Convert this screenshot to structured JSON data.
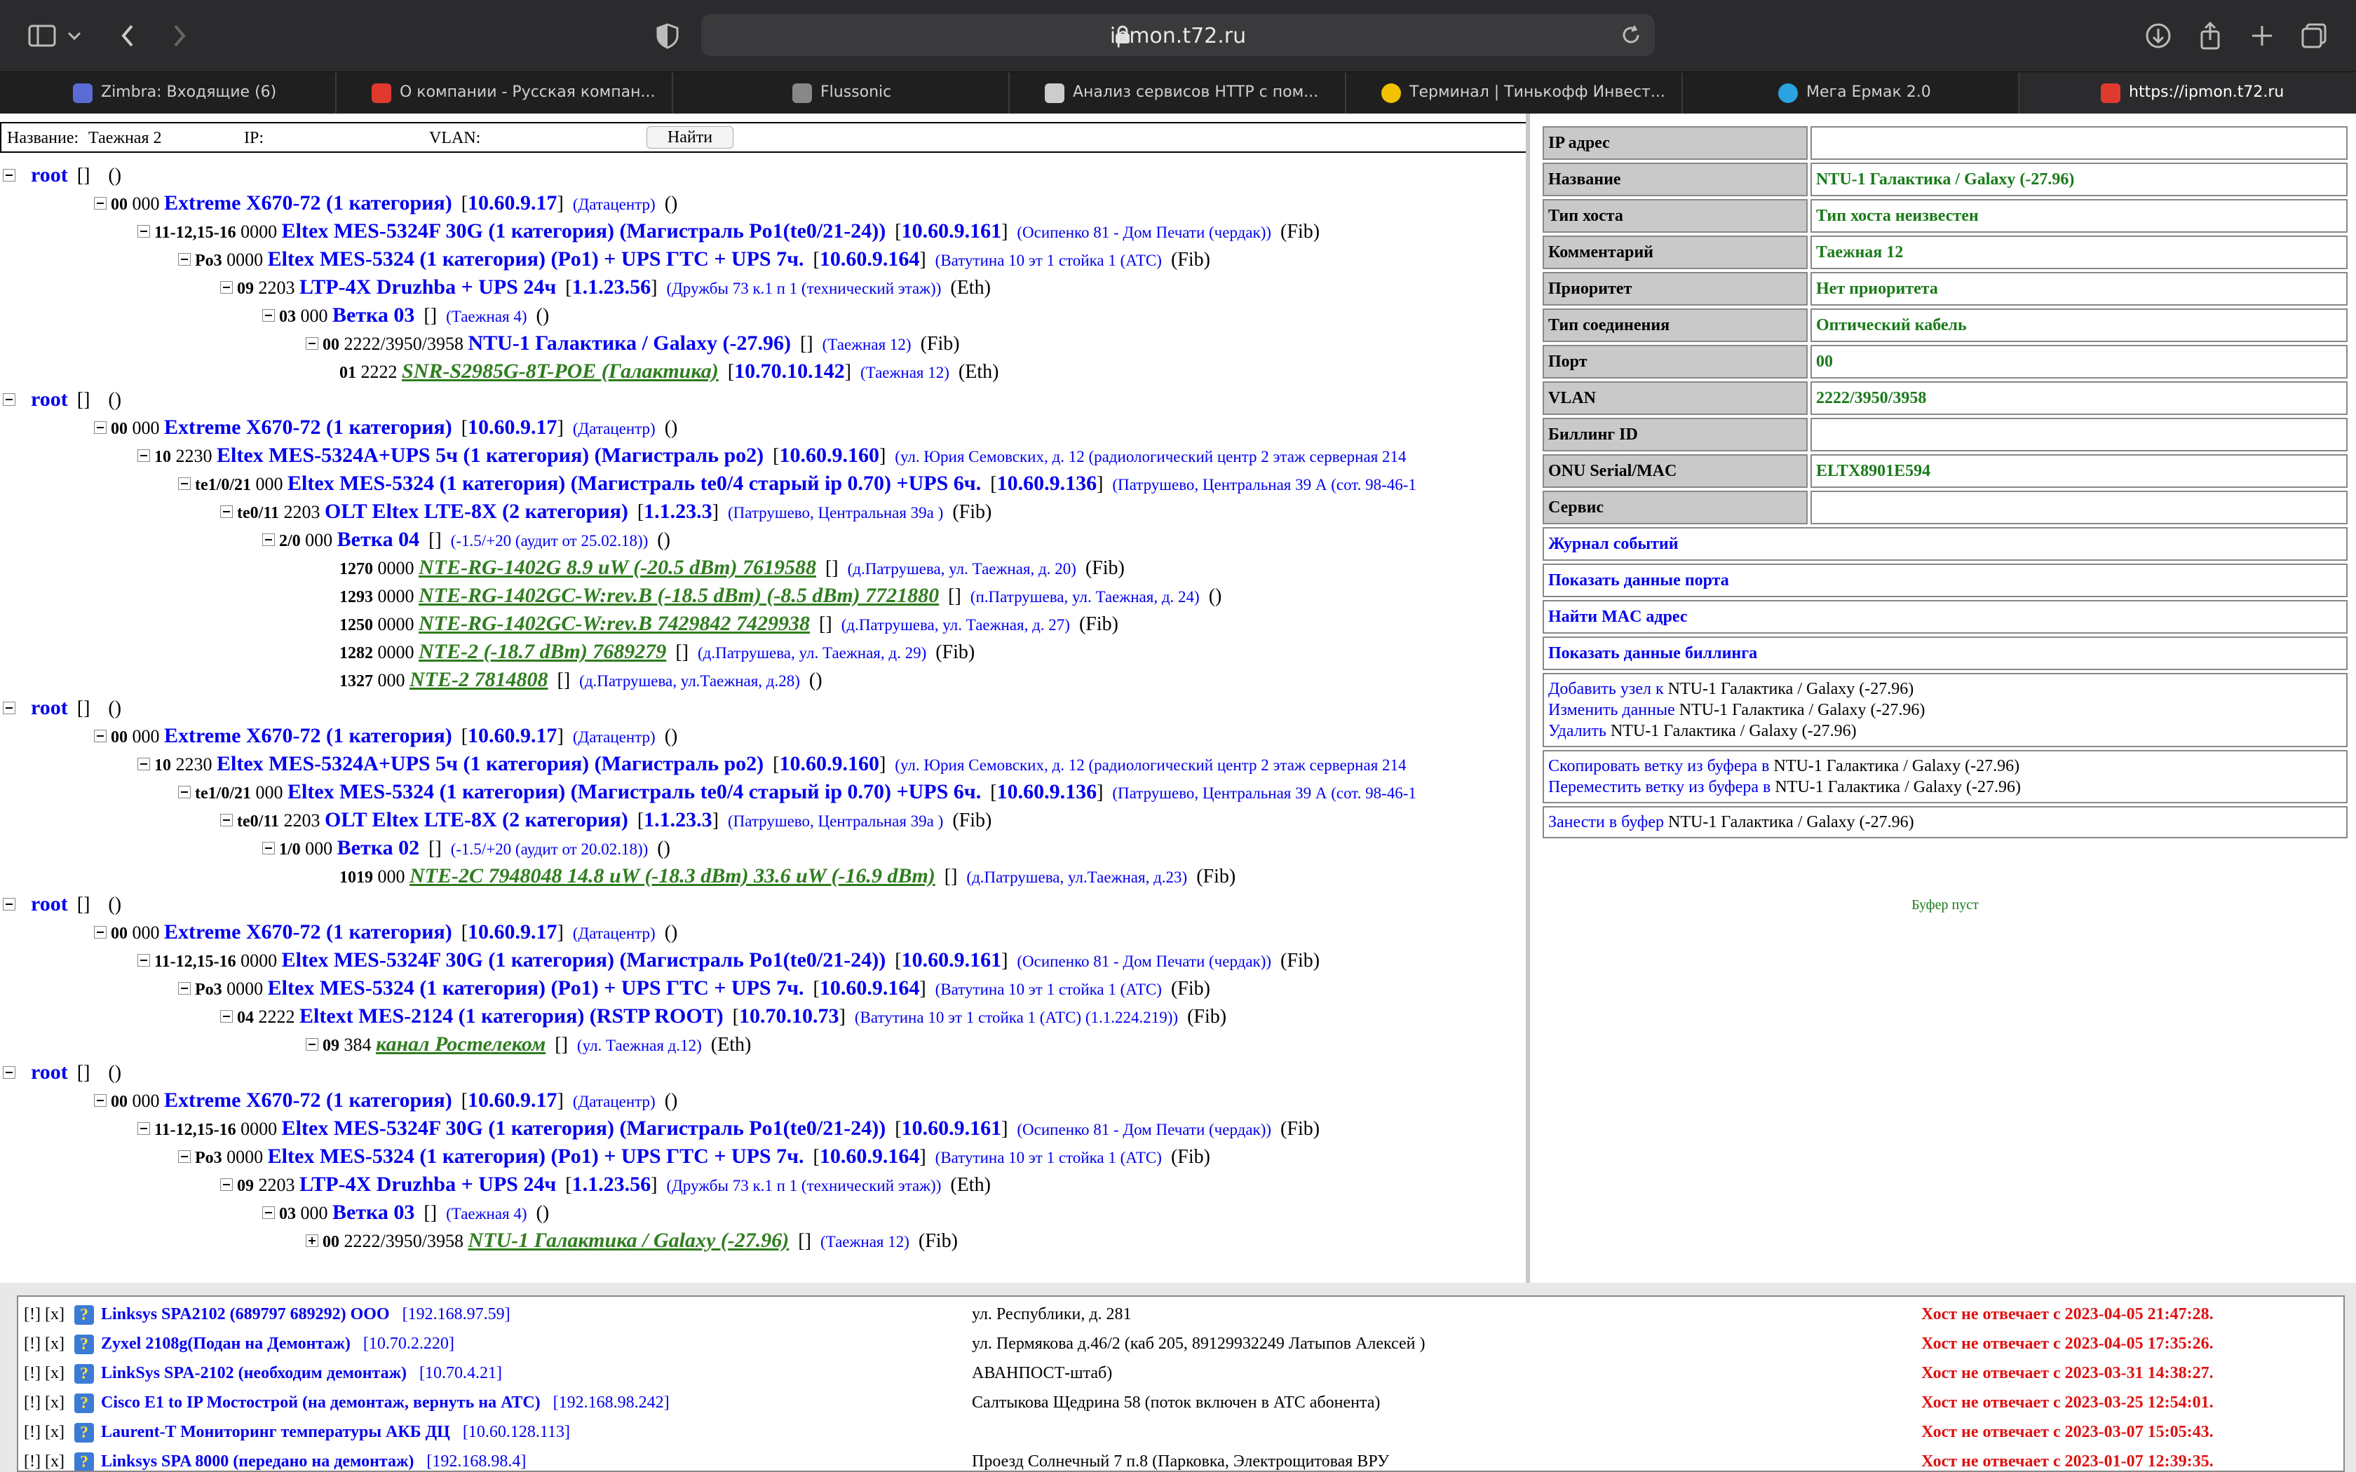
{
  "browser": {
    "url": "ipmon.t72.ru",
    "tabs": [
      {
        "label": "Zimbra: Входящие (6)",
        "icon": "zimbra-icon",
        "color": "#5b6bd6"
      },
      {
        "label": "О компании - Русская компан...",
        "icon": "company-icon",
        "color": "#e03a2f"
      },
      {
        "label": "Flussonic",
        "icon": "flussonic-icon",
        "color": "#888888"
      },
      {
        "label": "Анализ сервисов HTTP с пом...",
        "icon": "doc-icon",
        "color": "#cccccc"
      },
      {
        "label": "Терминал | Тинькофф Инвест...",
        "icon": "tinkoff-icon",
        "color": "#f2c200"
      },
      {
        "label": "Мега Ермак 2.0",
        "icon": "telegram-icon",
        "color": "#2aa3e0"
      },
      {
        "label": "https://ipmon.t72.ru",
        "icon": "ipmon-icon",
        "color": "#e03a2f"
      }
    ]
  },
  "search": {
    "name_label": "Название:",
    "name_value": "Таежная 2",
    "ip_label": "IP:",
    "ip_value": "",
    "vlan_label": "VLAN:",
    "vlan_value": "",
    "find_label": "Найти"
  },
  "tree": [
    {
      "kind": "root",
      "text": "root",
      "br": "[]",
      "typ": "()"
    },
    {
      "level": 1,
      "port": "00",
      "vlan": "000",
      "name": "Extreme X670-72 (1 категория)",
      "ip": "10.60.9.17",
      "loc": "(Датацентр)",
      "typ": "()"
    },
    {
      "level": 2,
      "port": "11-12,15-16",
      "vlan": "0000",
      "name": "Eltex MES-5324F 30G (1 категория) (Магистраль Po1(te0/21-24))",
      "ip": "10.60.9.161",
      "loc": "(Осипенко 81 - Дом Печати (чердак))",
      "typ": "(Fib)"
    },
    {
      "level": 3,
      "port": "Po3",
      "vlan": "0000",
      "name": "Eltex MES-5324 (1 категория) (Po1) + UPS ГТС + UPS 7ч.",
      "ip": "10.60.9.164",
      "loc": "(Ватутина 10 эт 1 стойка 1 (АТС)",
      "typ": "(Fib)"
    },
    {
      "level": 4,
      "port": "09",
      "vlan": "2203",
      "name": "LTP-4X Druzhba + UPS 24ч",
      "ip": "1.1.23.56",
      "loc": "(Дружбы 73 к.1 п 1 (технический этаж))",
      "typ": "(Eth)"
    },
    {
      "level": 5,
      "port": "03",
      "vlan": "000",
      "name": "Ветка 03",
      "ip": "",
      "loc": "(Таежная 4)",
      "typ": "()"
    },
    {
      "level": 6,
      "port": "00",
      "vlan": "2222/3950/3958",
      "name": "NTU-1 Галактика / Galaxy (-27.96)",
      "ip": "",
      "loc": "(Таежная 12)",
      "typ": "(Fib)"
    },
    {
      "level": 7,
      "port": "01",
      "vlan": "2222",
      "name": "SNR-S2985G-8T-POE (Галактика)",
      "green": true,
      "ip": "10.70.10.142",
      "loc": "(Таежная 12)",
      "typ": "(Eth)"
    },
    {
      "kind": "root",
      "text": "root",
      "br": "[]",
      "typ": "()"
    },
    {
      "level": 1,
      "port": "00",
      "vlan": "000",
      "name": "Extreme X670-72 (1 категория)",
      "ip": "10.60.9.17",
      "loc": "(Датацентр)",
      "typ": "()"
    },
    {
      "level": 2,
      "port": "10",
      "vlan": "2230",
      "name": "Eltex MES-5324A+UPS 5ч (1 категория) (Магистраль po2)",
      "ip": "10.60.9.160",
      "loc": "(ул. Юрия Семовских, д. 12 (радиологический центр 2 этаж серверная 214",
      "typ": ""
    },
    {
      "level": 3,
      "port": "te1/0/21",
      "vlan": "000",
      "name": "Eltex MES-5324 (1 категория) (Магистраль te0/4 старый ip 0.70) +UPS 6ч.",
      "ip": "10.60.9.136",
      "loc": "(Патрушево, Центральная 39 А (сот. 98-46-1",
      "typ": ""
    },
    {
      "level": 4,
      "port": "te0/11",
      "vlan": "2203",
      "name": "OLT Eltex LTE-8X (2 категория)",
      "ip": "1.1.23.3",
      "loc": "(Патрушево, Центральная 39а )",
      "typ": "(Fib)"
    },
    {
      "level": 5,
      "port": "2/0",
      "vlan": "000",
      "name": "Ветка 04",
      "ip": "",
      "loc": "(-1.5/+20 (аудит от 25.02.18))",
      "typ": "()"
    },
    {
      "level": 7,
      "port": "1270",
      "vlan": "0000",
      "name": "NTE-RG-1402G 8.9 uW (-20.5 dBm) 7619588",
      "green": true,
      "ip": "",
      "loc": "(д.Патрушева, ул. Таежная, д. 20)",
      "typ": "(Fib)"
    },
    {
      "level": 7,
      "port": "1293",
      "vlan": "0000",
      "name": "NTE-RG-1402GC-W:rev.B (-18.5 dBm) (-8.5 dBm) 7721880",
      "green": true,
      "ip": "",
      "loc": "(п.Патрушева, ул. Таежная, д. 24)",
      "typ": "()"
    },
    {
      "level": 7,
      "port": "1250",
      "vlan": "0000",
      "name": "NTE-RG-1402GC-W:rev.B 7429842 7429938",
      "green": true,
      "ip": "",
      "loc": "(д.Патрушева, ул. Таежная, д. 27)",
      "typ": "(Fib)"
    },
    {
      "level": 7,
      "port": "1282",
      "vlan": "0000",
      "name": "NTE-2 (-18.7 dBm) 7689279",
      "green": true,
      "ip": "",
      "loc": "(д.Патрушева, ул. Таежная, д. 29)",
      "typ": "(Fib)"
    },
    {
      "level": 7,
      "port": "1327",
      "vlan": "000",
      "name": "NTE-2 7814808",
      "green": true,
      "ip": "",
      "loc": "(д.Патрушева, ул.Таежная, д.28)",
      "typ": "()"
    },
    {
      "kind": "root",
      "text": "root",
      "br": "[]",
      "typ": "()"
    },
    {
      "level": 1,
      "port": "00",
      "vlan": "000",
      "name": "Extreme X670-72 (1 категория)",
      "ip": "10.60.9.17",
      "loc": "(Датацентр)",
      "typ": "()"
    },
    {
      "level": 2,
      "port": "10",
      "vlan": "2230",
      "name": "Eltex MES-5324A+UPS 5ч (1 категория) (Магистраль po2)",
      "ip": "10.60.9.160",
      "loc": "(ул. Юрия Семовских, д. 12 (радиологический центр 2 этаж серверная 214",
      "typ": ""
    },
    {
      "level": 3,
      "port": "te1/0/21",
      "vlan": "000",
      "name": "Eltex MES-5324 (1 категория) (Магистраль te0/4 старый ip 0.70) +UPS 6ч.",
      "ip": "10.60.9.136",
      "loc": "(Патрушево, Центральная 39 А (сот. 98-46-1",
      "typ": ""
    },
    {
      "level": 4,
      "port": "te0/11",
      "vlan": "2203",
      "name": "OLT Eltex LTE-8X (2 категория)",
      "ip": "1.1.23.3",
      "loc": "(Патрушево, Центральная 39а )",
      "typ": "(Fib)"
    },
    {
      "level": 5,
      "port": "1/0",
      "vlan": "000",
      "name": "Ветка 02",
      "ip": "",
      "loc": "(-1.5/+20 (аудит от 20.02.18))",
      "typ": "()"
    },
    {
      "level": 7,
      "port": "1019",
      "vlan": "000",
      "name": "NTE-2C 7948048 14.8 uW (-18.3 dBm) 33.6 uW (-16.9 dBm)",
      "green": true,
      "ip": "",
      "loc": "(д.Патрушева, ул.Таежная, д.23)",
      "typ": "(Fib)"
    },
    {
      "kind": "root",
      "text": "root",
      "br": "[]",
      "typ": "()"
    },
    {
      "level": 1,
      "port": "00",
      "vlan": "000",
      "name": "Extreme X670-72 (1 категория)",
      "ip": "10.60.9.17",
      "loc": "(Датацентр)",
      "typ": "()"
    },
    {
      "level": 2,
      "port": "11-12,15-16",
      "vlan": "0000",
      "name": "Eltex MES-5324F 30G (1 категория) (Магистраль Po1(te0/21-24))",
      "ip": "10.60.9.161",
      "loc": "(Осипенко 81 - Дом Печати (чердак))",
      "typ": "(Fib)"
    },
    {
      "level": 3,
      "port": "Po3",
      "vlan": "0000",
      "name": "Eltex MES-5324 (1 категория) (Po1) + UPS ГТС + UPS 7ч.",
      "ip": "10.60.9.164",
      "loc": "(Ватутина 10 эт 1 стойка 1 (АТС)",
      "typ": "(Fib)"
    },
    {
      "level": 4,
      "port": "04",
      "vlan": "2222",
      "name": "Eltext MES-2124 (1 категория) (RSTP ROOT)",
      "ip": "10.70.10.73",
      "loc": "(Ватутина 10 эт 1 стойка 1 (АТС) (1.1.224.219))",
      "typ": "(Fib)"
    },
    {
      "level": 6,
      "port": "09",
      "vlan": "384",
      "name": "канал Ростелеком",
      "green": true,
      "ip": "",
      "loc": "(ул. Таежная д.12)",
      "typ": "(Eth)"
    },
    {
      "kind": "root",
      "text": "root",
      "br": "[]",
      "typ": "()"
    },
    {
      "level": 1,
      "port": "00",
      "vlan": "000",
      "name": "Extreme X670-72 (1 категория)",
      "ip": "10.60.9.17",
      "loc": "(Датацентр)",
      "typ": "()"
    },
    {
      "level": 2,
      "port": "11-12,15-16",
      "vlan": "0000",
      "name": "Eltex MES-5324F 30G (1 категория) (Магистраль Po1(te0/21-24))",
      "ip": "10.60.9.161",
      "loc": "(Осипенко 81 - Дом Печати (чердак))",
      "typ": "(Fib)"
    },
    {
      "level": 3,
      "port": "Po3",
      "vlan": "0000",
      "name": "Eltex MES-5324 (1 категория) (Po1) + UPS ГТС + UPS 7ч.",
      "ip": "10.60.9.164",
      "loc": "(Ватутина 10 эт 1 стойка 1 (АТС)",
      "typ": "(Fib)"
    },
    {
      "level": 4,
      "port": "09",
      "vlan": "2203",
      "name": "LTP-4X Druzhba + UPS 24ч",
      "ip": "1.1.23.56",
      "loc": "(Дружбы 73 к.1 п 1 (технический этаж))",
      "typ": "(Eth)"
    },
    {
      "level": 5,
      "port": "03",
      "vlan": "000",
      "name": "Ветка 03",
      "ip": "",
      "loc": "(Таежная 4)",
      "typ": "()"
    },
    {
      "level": 6,
      "port": "00",
      "vlan": "2222/3950/3958",
      "name": "NTU-1 Галактика / Galaxy (-27.96)",
      "green": true,
      "plus": true,
      "ip": "",
      "loc": "(Таежная 12)",
      "typ": "(Fib)"
    }
  ],
  "info": {
    "rows": [
      {
        "k": "IP адрес",
        "v": ""
      },
      {
        "k": "Название",
        "v": "NTU-1 Галактика / Galaxy (-27.96)"
      },
      {
        "k": "Тип хоста",
        "v": "Тип хоста неизвестен"
      },
      {
        "k": "Комментарий",
        "v": "Таежная 12"
      },
      {
        "k": "Приоритет",
        "v": "Нет приоритета"
      },
      {
        "k": "Тип соединения",
        "v": "Оптический кабель"
      },
      {
        "k": "Порт",
        "v": "00"
      },
      {
        "k": "VLAN",
        "v": "2222/3950/3958"
      },
      {
        "k": "Биллинг ID",
        "v": ""
      },
      {
        "k": "ONU Serial/MAC",
        "v": "ELTX8901E594"
      },
      {
        "k": "Сервис",
        "v": ""
      }
    ],
    "links": [
      "Журнал событий",
      "Показать данные порта",
      "Найти MAC адрес",
      "Показать данные биллинга"
    ],
    "edit": {
      "add_prefix": "Добавить узел к",
      "edit_prefix": "Изменить данные",
      "delete_prefix": "Удалить",
      "copy_prefix": "Скопировать ветку из буфера в",
      "move_prefix": "Переместить ветку из буфера в",
      "buffer_prefix": "Занести в буфер",
      "target": "NTU-1 Галактика / Galaxy (-27.96)"
    },
    "buffer_status": "Буфер пуст"
  },
  "alerts": [
    {
      "marks": "[!] [x]",
      "name": "Linksys SPA2102 (689797 689292) OOO",
      "ip": "[192.168.97.59]",
      "addr": "ул. Республики, д. 281",
      "status": "Хост не отвечает с 2023-04-05 21:47:28."
    },
    {
      "marks": "[!] [x]",
      "name": "Zyxel 2108g(Подан на Демонтаж)",
      "ip": "[10.70.2.220]",
      "addr": "ул. Пермякова д.46/2 (каб 205, 89129932249 Латыпов Алексей )",
      "status": "Хост не отвечает с 2023-04-05 17:35:26."
    },
    {
      "marks": "[!] [x]",
      "name": "LinkSys SPA-2102 (необходим демонтаж)",
      "ip": "[10.70.4.21]",
      "addr": "АВАНПОСТ-штаб)",
      "status": "Хост не отвечает с 2023-03-31 14:38:27."
    },
    {
      "marks": "[!] [x]",
      "name": "Cisco E1 to IP Мостострой (на демонтаж, вернуть на АТС)",
      "ip": "[192.168.98.242]",
      "addr": "Салтыкова Щедрина 58 (поток включен в АТС абонента)",
      "status": "Хост не отвечает с 2023-03-25 12:54:01."
    },
    {
      "marks": "[!] [x]",
      "name": "Laurent-T Мониторинг температуры АКБ ДЦ",
      "ip": "[10.60.128.113]",
      "addr": "",
      "status": "Хост не отвечает с 2023-03-07 15:05:43."
    },
    {
      "marks": "[!] [x]",
      "name": "Linksys SPA 8000 (передано на демонтаж)",
      "ip": "[192.168.98.4]",
      "addr": "Проезд Солнечный 7 п.8 (Парковка, Электрощитовая ВРУ",
      "status": "Хост не отвечает с 2023-01-07 12:39:35."
    }
  ]
}
